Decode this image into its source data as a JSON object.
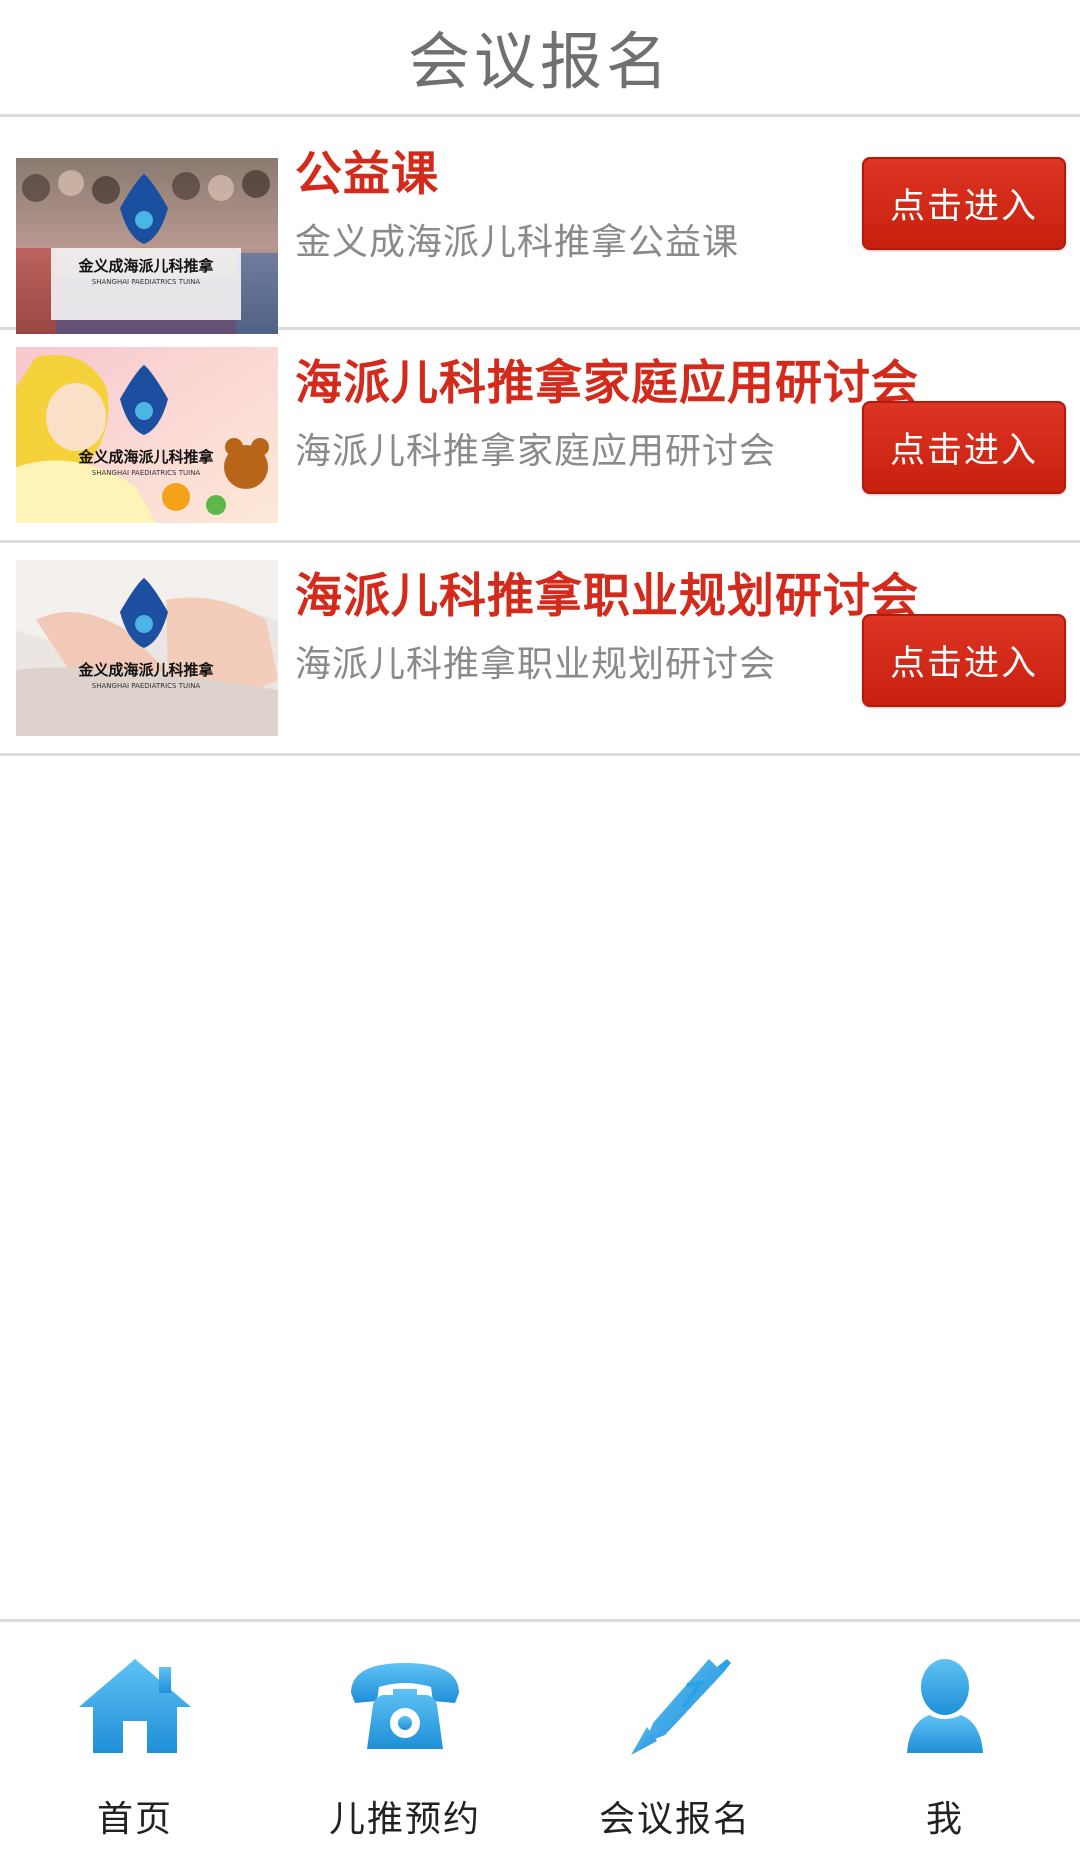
{
  "header": {
    "title": "会议报名"
  },
  "meetings": [
    {
      "title": "公益课",
      "subtitle": "金义成海派儿科推拿公益课",
      "button_label": "点击进入",
      "thumb_logo_text": "金义成海派儿科推拿",
      "thumb_logo_en": "SHANGHAI PAEDIATRICS TUINA"
    },
    {
      "title": "海派儿科推拿家庭应用研讨会",
      "subtitle": "海派儿科推拿家庭应用研讨会",
      "button_label": "点击进入",
      "thumb_logo_text": "金义成海派儿科推拿",
      "thumb_logo_en": "SHANGHAI PAEDIATRICS TUINA"
    },
    {
      "title": "海派儿科推拿职业规划研讨会",
      "subtitle": "海派儿科推拿职业规划研讨会",
      "button_label": "点击进入",
      "thumb_logo_text": "金义成海派儿科推拿",
      "thumb_logo_en": "SHANGHAI PAEDIATRICS TUINA"
    }
  ],
  "tabbar": {
    "items": [
      {
        "label": "首页",
        "icon": "home-icon"
      },
      {
        "label": "儿推预约",
        "icon": "telephone-icon"
      },
      {
        "label": "会议报名",
        "icon": "pen-icon"
      },
      {
        "label": "我",
        "icon": "user-icon"
      }
    ]
  },
  "colors": {
    "accent_red": "#d42a1b",
    "icon_blue": "#2aa3e6",
    "subtitle_gray": "#8a8a8a",
    "divider": "#dcdcdc"
  }
}
